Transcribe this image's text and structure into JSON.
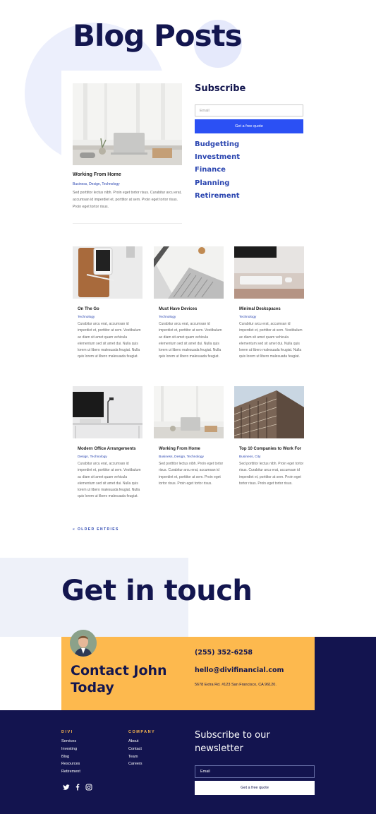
{
  "hero": {
    "title": "Blog Posts"
  },
  "featured": {
    "title": "Working From Home",
    "tags": "Business, Design, Technology",
    "excerpt": "Sed porttitor lectus nibh. Proin eget tortor risus. Curabitur arcu erat, accumsan id imperdiet et, porttitor at sem. Proin eget tortor risus. Proin eget tortor risus."
  },
  "subscribe": {
    "title": "Subscribe",
    "email_placeholder": "Email",
    "button_label": "Get a free quote"
  },
  "categories": [
    "Budgetting",
    "Investment",
    "Finance",
    "Planning",
    "Retirement"
  ],
  "posts": [
    {
      "title": "On The Go",
      "tags": "Technology",
      "excerpt": "Curabitur arcu erat, accumsan id imperdiet et, porttitor at sem. Vestibulum ac diam sit amet quam vehicula elementum sed sit amet dui. Nulla quis lorem ut libero malesuada feugiat. Nulla quis lorem ut libero malesuada feugiat."
    },
    {
      "title": "Must Have Devices",
      "tags": "Technology",
      "excerpt": "Curabitur arcu erat, accumsan id imperdiet et, porttitor at sem. Vestibulum ac diam sit amet quam vehicula elementum sed sit amet dui. Nulla quis lorem ut libero malesuada feugiat. Nulla quis lorem ut libero malesuada feugiat."
    },
    {
      "title": "Minimal Deskspaces",
      "tags": "Technology",
      "excerpt": "Curabitur arcu erat, accumsan id imperdiet et, porttitor at sem. Vestibulum ac diam sit amet quam vehicula elementum sed sit amet dui. Nulla quis lorem ut libero malesuada feugiat. Nulla quis lorem ut libero malesuada feugiat."
    },
    {
      "title": "Modern Office Arrangements",
      "tags": "Design, Technology",
      "excerpt": "Curabitur arcu erat, accumsan id imperdiet et, porttitor at sem. Vestibulum ac diam sit amet quam vehicula elementum sed sit amet dui. Nulla quis lorem ut libero malesuada feugiat. Nulla quis lorem ut libero malesuada feugiat."
    },
    {
      "title": "Working From Home",
      "tags": "Business, Design, Technology",
      "excerpt": "Sed porttitor lectus nibh. Proin eget tortor risus. Curabitur arcu erat, accumsan id imperdiet et, porttitor at sem. Proin eget tortor risus. Proin eget tortor risus."
    },
    {
      "title": "Top 10 Companies to Work For",
      "tags": "Business, City",
      "excerpt": "Sed porttitor lectus nibh. Proin eget tortor risus. Curabitur arcu erat, accumsan id imperdiet et, porttitor at sem. Proin eget tortor risus. Proin eget tortor risus."
    }
  ],
  "older_entries": "« OLDER ENTRIES",
  "contact": {
    "section_title": "Get in touch",
    "name": "Contact John Today",
    "phone": "(255) 352-6258",
    "email": "hello@divifinancial.com",
    "address": "5678 Extra Rd. #123 San Francisco, CA 96120."
  },
  "footer": {
    "col1_title": "DIVI",
    "col1_links": [
      "Services",
      "Investing",
      "Blog",
      "Resources",
      "Retirement"
    ],
    "col2_title": "COMPANY",
    "col2_links": [
      "About",
      "Contact",
      "Team",
      "Careers"
    ],
    "newsletter_title": "Subscribe to our newsletter",
    "email_placeholder": "Email",
    "button_label": "Get a free quote",
    "social": [
      "twitter-icon",
      "facebook-icon",
      "instagram-icon"
    ]
  },
  "colors": {
    "navy": "#13144f",
    "accent_blue": "#2b50f4",
    "link_blue": "#2b46b0",
    "yellow": "#fdb94e",
    "pale": "#eef1f9"
  }
}
